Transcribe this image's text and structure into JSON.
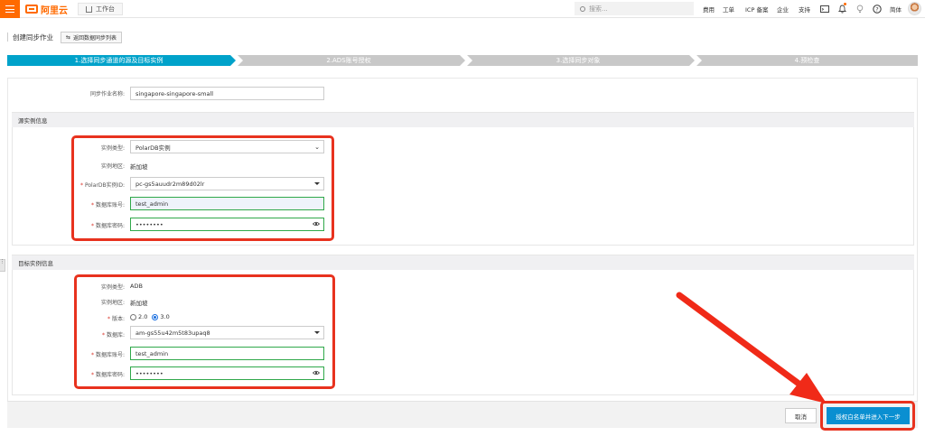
{
  "topbar": {
    "logo_text": "阿里云",
    "workbench_label": "工作台",
    "search_placeholder": "搜索...",
    "nav": [
      "费用",
      "工单",
      "ICP 备案",
      "企业",
      "支持"
    ],
    "lang": "简体",
    "icons": [
      "menu-icon",
      "home-icon",
      "search-icon",
      "terminal-icon",
      "bell-icon",
      "lightbulb-icon",
      "help-icon",
      "avatar"
    ],
    "accent": "#ff6a00"
  },
  "page": {
    "title": "创建同步作业",
    "back_label": "返回数据同步列表"
  },
  "steps": [
    {
      "label": "1.选择同步通道的源及目标实例",
      "active": true
    },
    {
      "label": "2.ADS账号授权",
      "active": false
    },
    {
      "label": "3.选择同步对象",
      "active": false
    },
    {
      "label": "4.预检查",
      "active": false
    }
  ],
  "form": {
    "job_name_label": "同步作业名称:",
    "job_name_value": "singapore-singapore-small",
    "source": {
      "section_title": "源实例信息",
      "instance_type_label": "实例类型:",
      "instance_type_value": "PolarDB实例",
      "region_label": "实例地区:",
      "region_value": "新加坡",
      "instance_id_label": "PolarDB实例ID:",
      "instance_id_value": "pc-gs5auudr2m89d02lr",
      "account_label": "数据库账号:",
      "account_value": "test_admin",
      "password_label": "数据库密码:",
      "password_value": "••••••••"
    },
    "target": {
      "section_title": "目标实例信息",
      "instance_type_label": "实例类型:",
      "instance_type_value": "ADB",
      "region_label": "实例地区:",
      "region_value": "新加坡",
      "version_label": "版本:",
      "version_options": [
        "2.0",
        "3.0"
      ],
      "version_selected": "3.0",
      "database_label": "数据库:",
      "database_value": "am-gs55u42m5t83upaq8",
      "account_label": "数据库账号:",
      "account_value": "test_admin",
      "password_label": "数据库密码:",
      "password_value": "••••••••"
    }
  },
  "footer": {
    "cancel_label": "取消",
    "next_label": "授权白名单并进入下一步"
  },
  "colors": {
    "step_active": "#00a2ca",
    "step_inactive": "#c8c8c8",
    "highlight": "#e8321e",
    "primary_button": "#0a8fd1"
  }
}
